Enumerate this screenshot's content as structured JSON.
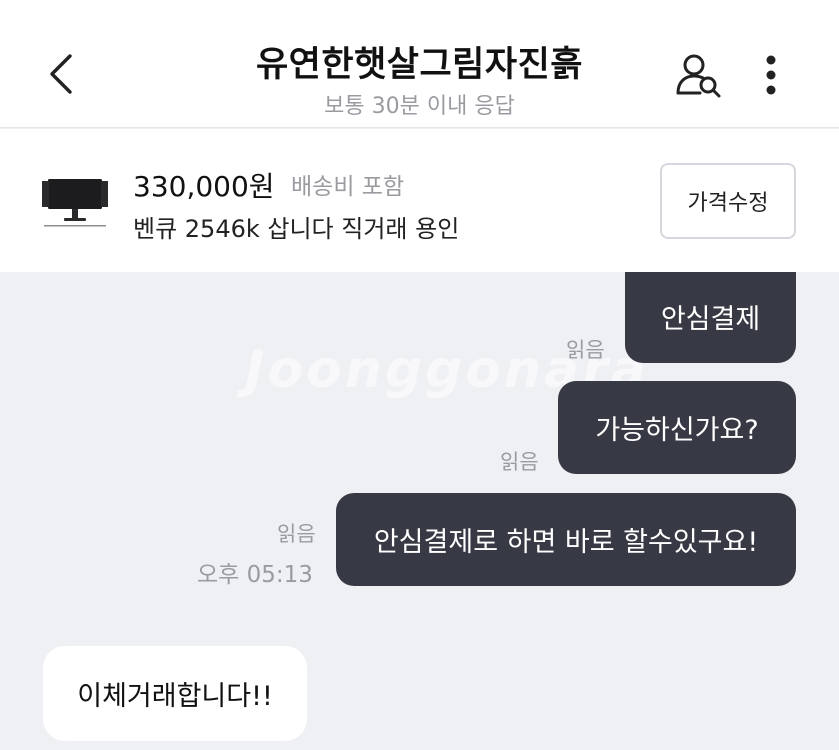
{
  "header": {
    "title": "유연한햇살그림자진흙",
    "subtitle": "보통 30분 이내 응답",
    "back_icon": "chevron-left-icon",
    "profile_icon": "user-search-icon",
    "more_icon": "more-vertical-icon"
  },
  "product": {
    "price": "330,000원",
    "shipping": "배송비 포함",
    "title": "벤큐 2546k 삽니다 직거래 용인",
    "edit_price_label": "가격수정",
    "thumbnail_icon": "monitor-icon"
  },
  "chat": {
    "watermark": "Joonggonara",
    "messages": [
      {
        "direction": "out",
        "text": "안심결제",
        "read": "읽음"
      },
      {
        "direction": "out",
        "text": "가능하신가요?",
        "read": "읽음"
      },
      {
        "direction": "out",
        "text": "안심결제로 하면 바로 할수있구요!",
        "read": "읽음",
        "time": "오후 05:13"
      },
      {
        "direction": "in",
        "text": "이체거래합니다!!"
      }
    ]
  },
  "colors": {
    "outgoing_bubble": "#373a45",
    "incoming_bubble": "#ffffff",
    "chat_background": "#eff0f4",
    "muted_text": "#9a9ba1"
  }
}
